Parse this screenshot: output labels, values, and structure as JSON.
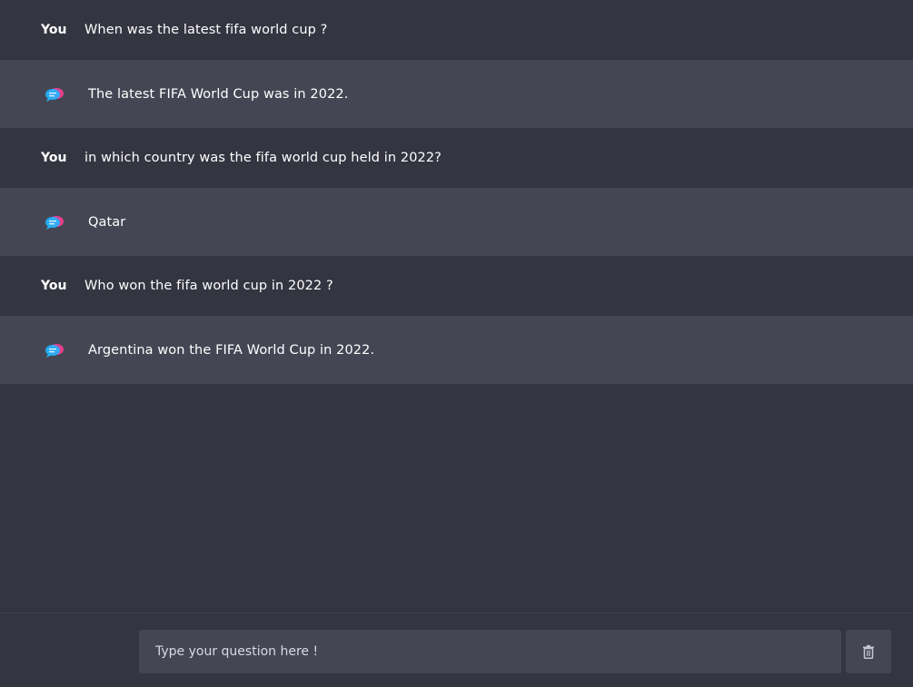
{
  "conversation": [
    {
      "role": "user",
      "sender_label": "You",
      "text": "When was the latest fifa world cup ?"
    },
    {
      "role": "bot",
      "icon": "chat-bubbles-icon",
      "text": "The latest FIFA World Cup was in 2022."
    },
    {
      "role": "user",
      "sender_label": "You",
      "text": "in which country was the fifa world cup held in 2022?"
    },
    {
      "role": "bot",
      "icon": "chat-bubbles-icon",
      "text": "Qatar"
    },
    {
      "role": "user",
      "sender_label": "You",
      "text": "Who won the fifa world cup in 2022 ?"
    },
    {
      "role": "bot",
      "icon": "chat-bubbles-icon",
      "text": "Argentina won the FIFA World Cup in 2022."
    }
  ],
  "composer": {
    "placeholder": "Type your question here !",
    "value": "",
    "clear_icon": "trash-icon"
  },
  "colors": {
    "background": "#343541",
    "bot_row": "#444654",
    "input_bg": "#444654",
    "text": "#ffffff",
    "icon_accent_pink": "#e83e8c",
    "icon_accent_blue": "#1fb6ff"
  }
}
